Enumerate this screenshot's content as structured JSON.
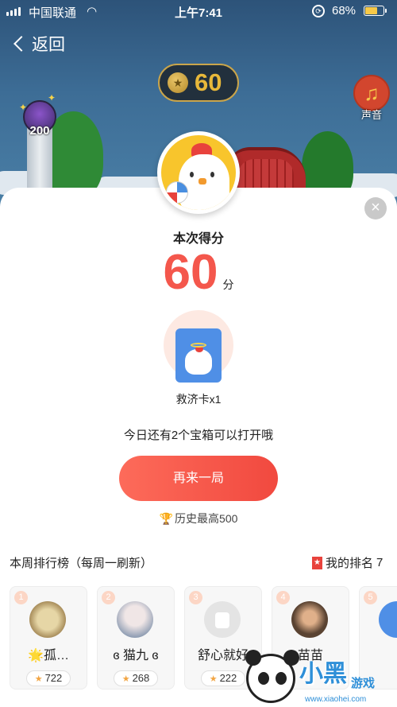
{
  "status_bar": {
    "carrier": "中国联通",
    "time": "上午7:41",
    "battery_percent": "68%",
    "battery_level": 0.68,
    "battery_color": "#f7c948"
  },
  "nav": {
    "back_label": "返回",
    "back_icon": "chevron-left-icon"
  },
  "game": {
    "coin_count": "60",
    "coin_icon": "star-coin-icon",
    "tower_value": "200",
    "sound_label": "声音",
    "sound_icon": "music-note-icon"
  },
  "result": {
    "score_title": "本次得分",
    "score_value": "60",
    "score_unit": "分",
    "reward_label": "救济卡x1",
    "chest_text": "今日还有2个宝箱可以打开哦",
    "again_label": "再来一局",
    "best_text": "历史最高500",
    "close_icon": "close-icon"
  },
  "leaderboard": {
    "title": "本周排行榜（每周一刷新）",
    "my_rank_label": "我的排名",
    "my_rank_value": "7",
    "entries": [
      {
        "rank": "1",
        "name": "🌟孤…",
        "score": "722",
        "avatar_color": "#c9b48a"
      },
      {
        "rank": "2",
        "name": "ɞ 猫九 ɞ",
        "score": "268",
        "avatar_color": "#9aa7b8"
      },
      {
        "rank": "3",
        "name": "舒心就好",
        "score": "222",
        "avatar_color": "#e4e4e4"
      },
      {
        "rank": "4",
        "name": "苗苗",
        "score": "",
        "avatar_color": "#6b5440"
      },
      {
        "rank": "5",
        "name": "",
        "score": "",
        "avatar_color": "#4f8fe6"
      }
    ]
  },
  "colors": {
    "accent_red": "#f4574c",
    "button_gradient_start": "#fd6b5a",
    "button_gradient_end": "#f1493f",
    "coin_gold": "#e8b83a"
  }
}
